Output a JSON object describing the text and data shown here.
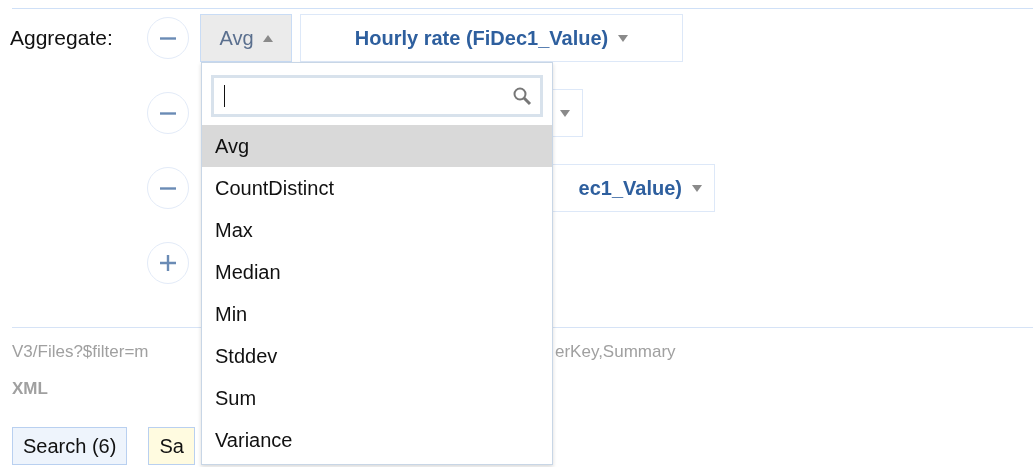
{
  "aggregate_label": "Aggregate:",
  "rows": [
    {
      "kind": "remove",
      "function": {
        "label": "Avg",
        "open": true
      },
      "field": "Hourly rate (FiDec1_Value)"
    },
    {
      "kind": "remove",
      "field_caret": true
    },
    {
      "kind": "remove",
      "field": "ec1_Value)"
    },
    {
      "kind": "add"
    }
  ],
  "query": {
    "left": "V3/Files?$filter=m",
    "right": "erKey,Summary"
  },
  "format": "XML",
  "buttons": [
    {
      "label": "Search (6)",
      "kind": "plain"
    },
    {
      "label": "Sa",
      "kind": "highlight"
    }
  ],
  "dropdown": {
    "options": [
      {
        "label": "Avg",
        "selected": true
      },
      {
        "label": "CountDistinct",
        "selected": false
      },
      {
        "label": "Max",
        "selected": false
      },
      {
        "label": "Median",
        "selected": false
      },
      {
        "label": "Min",
        "selected": false
      },
      {
        "label": "Stddev",
        "selected": false
      },
      {
        "label": "Sum",
        "selected": false
      },
      {
        "label": "Variance",
        "selected": false
      }
    ]
  }
}
